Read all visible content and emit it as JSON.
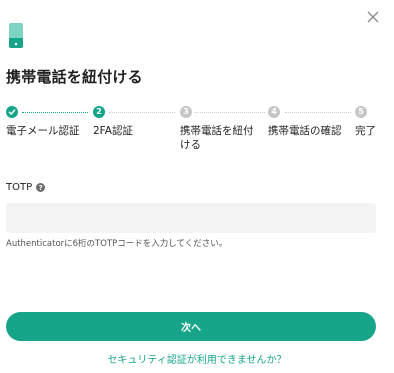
{
  "title": "携帯電話を紐付ける",
  "steps": [
    {
      "label": "電子メール認証",
      "status": "done"
    },
    {
      "label": "2FA認証",
      "number": "2",
      "status": "active"
    },
    {
      "label": "携帯電話を紐付ける",
      "number": "3",
      "status": "pending"
    },
    {
      "label": "携帯電話の確認",
      "number": "4",
      "status": "pending"
    },
    {
      "label": "完了",
      "number": "5",
      "status": "pending"
    }
  ],
  "field": {
    "label": "TOTP",
    "value": "",
    "placeholder": "",
    "hint": "Authenticatorに6桁のTOTPコードを入力してください。"
  },
  "primary_button": "次へ",
  "help_link": "セキュリティ認証が利用できませんか？",
  "colors": {
    "accent": "#17a589",
    "pending": "#c6c6c6",
    "input_bg": "#f4f4f4"
  },
  "icons": {
    "close": "close-icon",
    "header": "phone-icon",
    "help": "help-circle-icon",
    "check": "check-icon"
  }
}
